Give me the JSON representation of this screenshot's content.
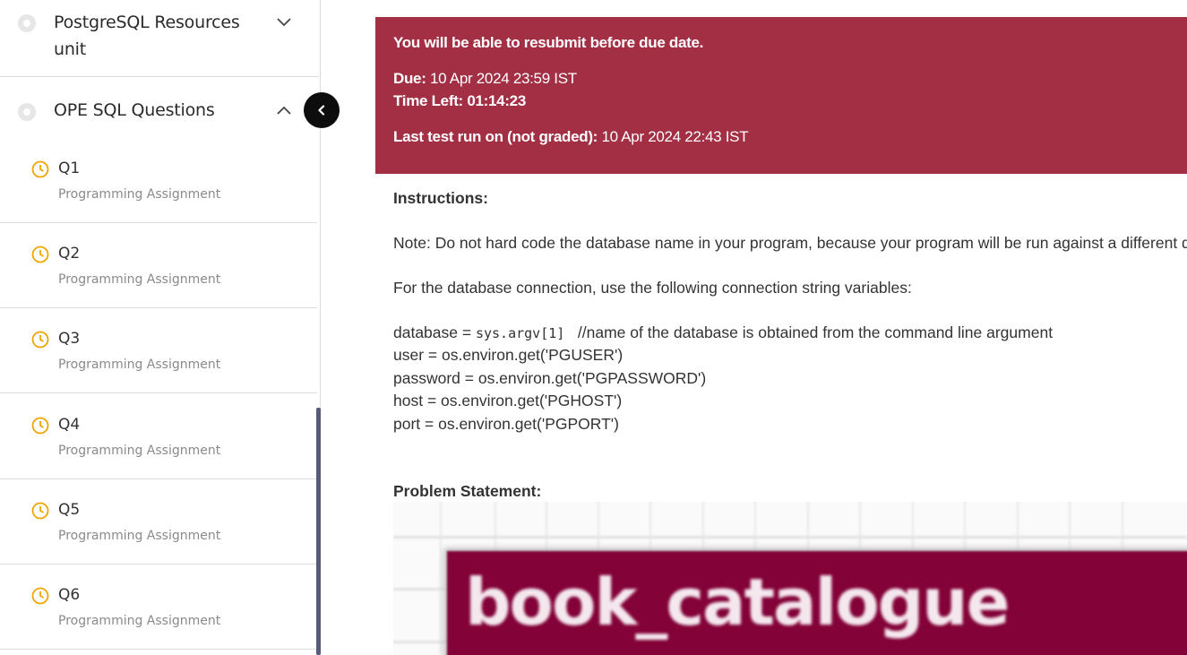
{
  "sidebar": {
    "units": [
      {
        "title_line1": "PostgreSQL Resources",
        "title_line2": "unit",
        "state": "collapsed"
      },
      {
        "title_line1": "OPE SQL Questions",
        "title_line2": "",
        "state": "expanded"
      }
    ],
    "items": [
      {
        "label": "Q1",
        "type": "Programming Assignment"
      },
      {
        "label": "Q2",
        "type": "Programming Assignment"
      },
      {
        "label": "Q3",
        "type": "Programming Assignment"
      },
      {
        "label": "Q4",
        "type": "Programming Assignment"
      },
      {
        "label": "Q5",
        "type": "Programming Assignment"
      },
      {
        "label": "Q6",
        "type": "Programming Assignment"
      }
    ]
  },
  "banner": {
    "resubmit_text": "You will be able to resubmit before due date.",
    "due_label": "Due:",
    "due_value": " 10 Apr 2024 23:59 IST",
    "time_left_label": "Time Left:",
    "time_left_value": " 01:14:23",
    "last_run_label": "Last test run on (not graded):",
    "last_run_value": " 10 Apr 2024 22:43 IST"
  },
  "instructions": {
    "heading": "Instructions:",
    "note": "Note: Do not hard code the database name in your program, because your program will be run against a different d",
    "connection_intro": "For the database connection, use the following connection string variables:",
    "db_prefix": "database = ",
    "db_code": "sys.argv[1]",
    "db_comment": "   //name of the database is obtained from the command line argument",
    "user_line": "user = os.environ.get('PGUSER')",
    "password_line": "password = os.environ.get('PGPASSWORD')",
    "host_line": "host = os.environ.get('PGHOST')",
    "port_line": "port = os.environ.get('PGPORT')"
  },
  "problem": {
    "heading": "Problem Statement:",
    "image_text": "book_catalogue"
  },
  "colors": {
    "banner_bg": "#a32f45",
    "clock_icon": "#f0a500",
    "image_box": "#830238",
    "scrollbar": "#555b78"
  }
}
